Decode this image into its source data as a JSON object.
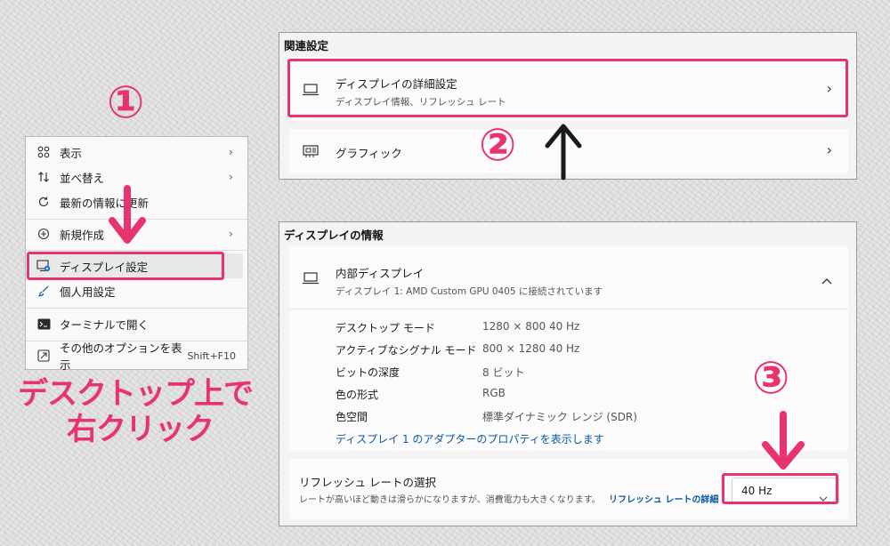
{
  "context_menu": {
    "items": [
      {
        "label": "表示",
        "icon": "grid-icon",
        "has_submenu": true
      },
      {
        "label": "並べ替え",
        "icon": "sort-icon",
        "has_submenu": true
      },
      {
        "label": "最新の情報に更新",
        "icon": "refresh-icon",
        "has_submenu": false
      },
      {
        "label": "新規作成",
        "icon": "plus-circle-icon",
        "has_submenu": true
      },
      {
        "label": "ディスプレイ設定",
        "icon": "display-settings-icon",
        "has_submenu": false
      },
      {
        "label": "個人用設定",
        "icon": "brush-icon",
        "has_submenu": false
      },
      {
        "label": "ターミナルで開く",
        "icon": "terminal-icon",
        "has_submenu": false
      },
      {
        "label": "その他のオプションを表示",
        "icon": "more-options-icon",
        "shortcut": "Shift+F10"
      }
    ]
  },
  "related_settings": {
    "header": "関連設定",
    "advanced_display": {
      "title": "ディスプレイの詳細設定",
      "subtitle": "ディスプレイ情報、リフレッシュ レート"
    },
    "graphics": {
      "title": "グラフィック"
    }
  },
  "display_info": {
    "header": "ディスプレイの情報",
    "monitor": {
      "title": "内部ディスプレイ",
      "subtitle": "ディスプレイ 1: AMD Custom GPU 0405 に接続されています"
    },
    "specs": [
      {
        "label": "デスクトップ モード",
        "value": "1280 × 800 40 Hz"
      },
      {
        "label": "アクティブなシグナル モード",
        "value": "800 × 1280 40 Hz"
      },
      {
        "label": "ビットの深度",
        "value": "8 ビット"
      },
      {
        "label": "色の形式",
        "value": "RGB"
      },
      {
        "label": "色空間",
        "value": "標準ダイナミック レンジ (SDR)"
      }
    ],
    "adapter_link": "ディスプレイ 1 のアダプターのプロパティを表示します",
    "refresh": {
      "title": "リフレッシュ レートの選択",
      "description": "レートが高いほど動きは滑らかになりますが、消費電力も大きくなります。",
      "link": "リフレッシュ レートの詳細",
      "selected": "40 Hz"
    }
  },
  "annotations": {
    "step1": "①",
    "step2": "②",
    "step3": "③",
    "note_line1": "デスクトップ上で",
    "note_line2": "右クリック"
  },
  "colors": {
    "highlight": "#e8336c",
    "link": "#0b57a8"
  }
}
